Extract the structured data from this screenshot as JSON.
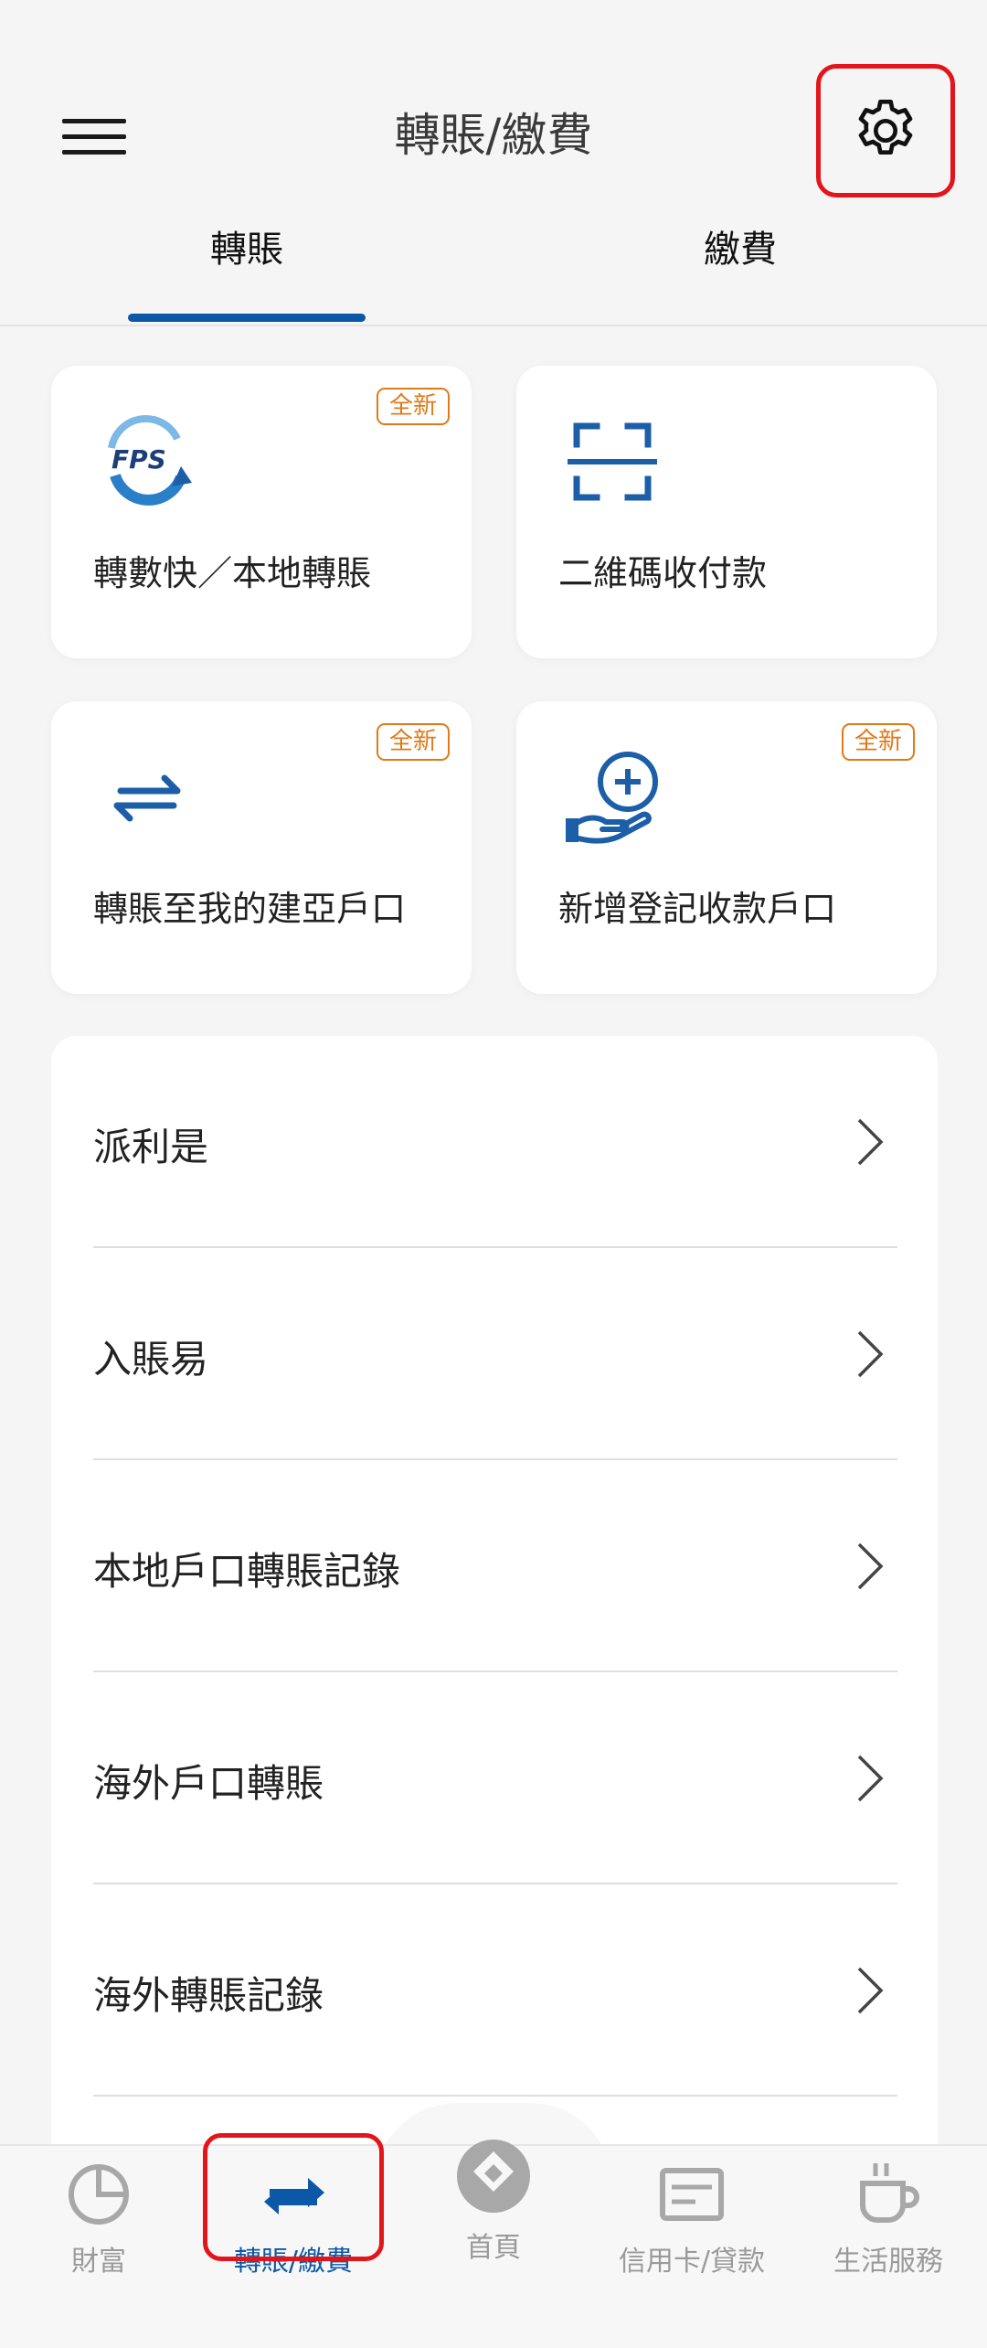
{
  "header": {
    "title": "轉賬/繳費",
    "menu_icon": "hamburger-menu-icon",
    "settings_icon": "gear-icon"
  },
  "tabs": [
    {
      "label": "轉賬",
      "active": true
    },
    {
      "label": "繳費",
      "active": false
    }
  ],
  "quick_actions": [
    {
      "label": "轉數快／本地轉賬",
      "badge": "全新",
      "icon": "fps-icon"
    },
    {
      "label": "二維碼收付款",
      "badge": "",
      "icon": "qr-scan-icon"
    },
    {
      "label": "轉賬至我的建亞戶口",
      "badge": "全新",
      "icon": "transfer-arrows-icon"
    },
    {
      "label": "新增登記收款戶口",
      "badge": "全新",
      "icon": "hand-add-icon"
    }
  ],
  "menu_list": [
    {
      "label": "派利是"
    },
    {
      "label": "入賬易"
    },
    {
      "label": "本地戶口轉賬記錄"
    },
    {
      "label": "海外戶口轉賬"
    },
    {
      "label": "海外轉賬記錄"
    }
  ],
  "bottom_nav": [
    {
      "label": "財富",
      "icon": "pie-chart-icon",
      "active": false
    },
    {
      "label": "轉賬/繳費",
      "icon": "transfer-arrows-icon",
      "active": true
    },
    {
      "label": "首頁",
      "icon": "home-logo-icon",
      "active": false
    },
    {
      "label": "信用卡/貸款",
      "icon": "credit-card-icon",
      "active": false
    },
    {
      "label": "生活服務",
      "icon": "coffee-cup-icon",
      "active": false
    }
  ],
  "colors": {
    "accent": "#0b58a6",
    "badge": "#e07a19",
    "highlight": "#e3151a"
  }
}
